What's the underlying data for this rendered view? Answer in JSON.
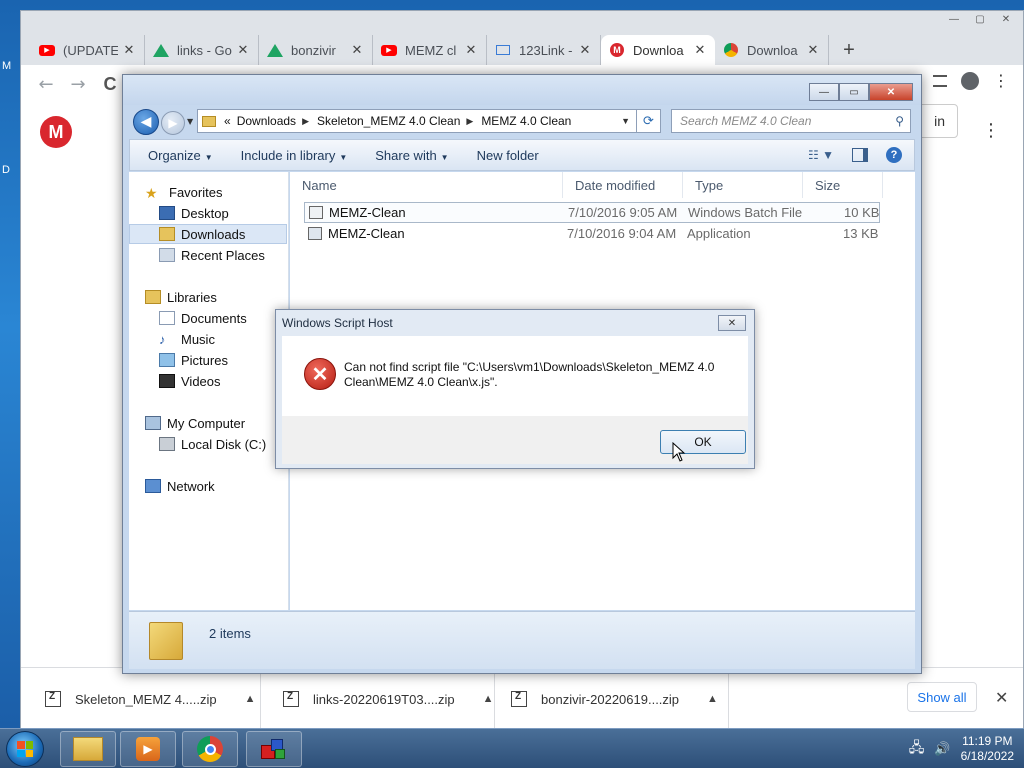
{
  "desktop": {
    "edge_letter_top": "M",
    "edge_letter_mid": "D"
  },
  "browser": {
    "window_controls": [
      "—",
      "▢",
      "✕"
    ],
    "tabs": [
      {
        "label": "(UPDATE",
        "favicon": "youtube-icon",
        "favicon_color": "#ff0000"
      },
      {
        "label": "links - Go",
        "favicon": "google-drive-icon",
        "favicon_color": "#1fa463"
      },
      {
        "label": "bonzivir",
        "favicon": "google-drive-icon",
        "favicon_color": "#1fa463"
      },
      {
        "label": "MEMZ cl",
        "favicon": "youtube-icon",
        "favicon_color": "#ff0000"
      },
      {
        "label": "123Link -",
        "favicon": "link-icon",
        "favicon_color": "#3a7bd5"
      },
      {
        "label": "Downloa",
        "favicon": "mega-icon",
        "favicon_color": "#d9272e",
        "active": true
      },
      {
        "label": "Downloa",
        "favicon": "chrome-icon",
        "favicon_color": "#f4b400"
      }
    ],
    "new_tab": "+",
    "nav": {
      "back": "←",
      "forward": "→",
      "reload": "C"
    },
    "page": {
      "logo": "M",
      "signin_label": "in",
      "menu": "⋮"
    },
    "downloads": [
      {
        "name": "Skeleton_MEMZ 4.....zip"
      },
      {
        "name": "links-20220619T03....zip"
      },
      {
        "name": "bonzivir-20220619....zip"
      }
    ],
    "show_all": "Show all",
    "shelf_close": "✕"
  },
  "explorer": {
    "title": "",
    "controls": [
      "—",
      "▭",
      "✕"
    ],
    "breadcrumb": [
      "«",
      "Downloads",
      "Skeleton_MEMZ 4.0 Clean",
      "MEMZ 4.0 Clean"
    ],
    "search_placeholder": "Search MEMZ 4.0 Clean",
    "commands": [
      "Organize",
      "Include in library",
      "Share with",
      "New folder"
    ],
    "nav": {
      "favorites": "Favorites",
      "desktop": "Desktop",
      "downloads": "Downloads",
      "recent": "Recent Places",
      "libraries": "Libraries",
      "documents": "Documents",
      "music": "Music",
      "pictures": "Pictures",
      "videos": "Videos",
      "computer": "My Computer",
      "localdisk": "Local Disk (C:)",
      "network": "Network"
    },
    "columns": [
      "Name",
      "Date modified",
      "Type",
      "Size"
    ],
    "files": [
      {
        "name": "MEMZ-Clean",
        "date": "7/10/2016 9:05 AM",
        "type": "Windows Batch File",
        "size": "10 KB"
      },
      {
        "name": "MEMZ-Clean",
        "date": "7/10/2016 9:04 AM",
        "type": "Application",
        "size": "13 KB"
      }
    ],
    "status": "2 items"
  },
  "dialog": {
    "title": "Windows Script Host",
    "message": "Can not find script file \"C:\\Users\\vm1\\Downloads\\Skeleton_MEMZ 4.0 Clean\\MEMZ 4.0 Clean\\x.js\".",
    "ok": "OK",
    "close": "✕"
  },
  "taskbar": {
    "time": "11:19 PM",
    "date": "6/18/2022"
  }
}
